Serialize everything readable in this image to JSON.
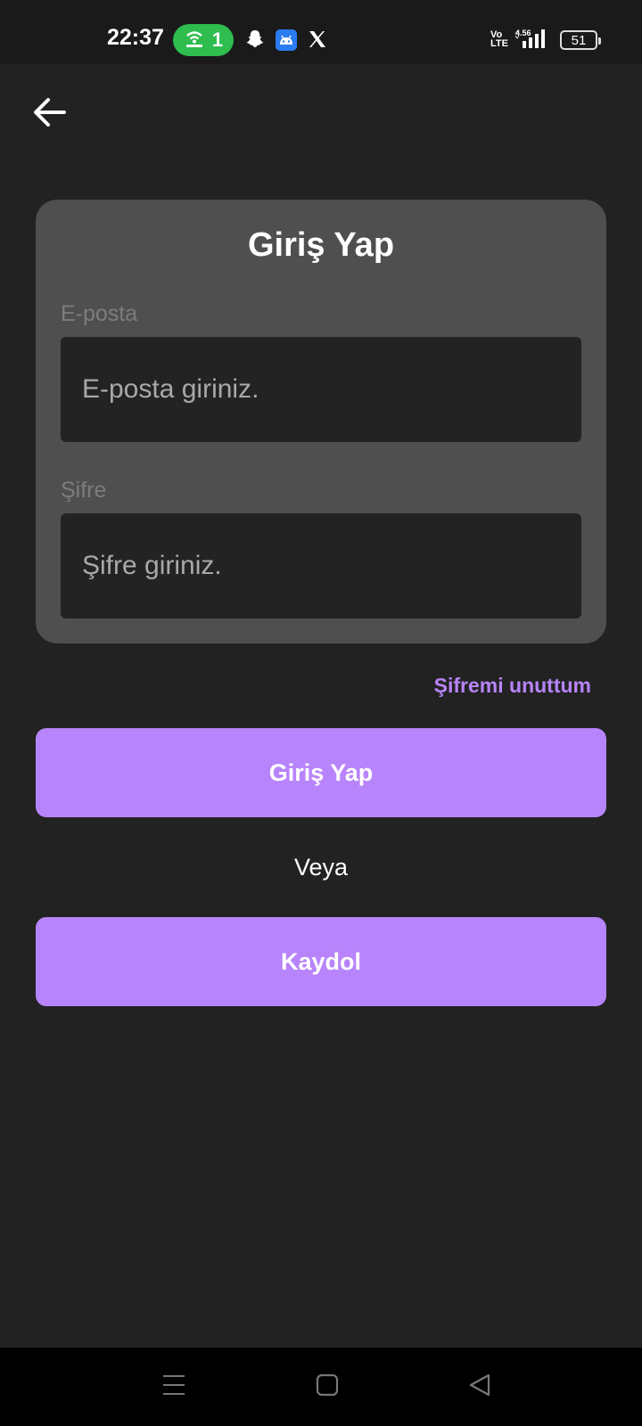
{
  "status_bar": {
    "time": "22:37",
    "hotspot_count": "1",
    "volte_label": "Vo\nLTE",
    "net_speed": "4.56",
    "battery_level": "51",
    "icons": [
      "hotspot-icon",
      "snapchat-icon",
      "android-icon",
      "x-icon",
      "signal-icon",
      "battery-icon"
    ]
  },
  "header": {
    "back_icon": "arrow-left-icon"
  },
  "login_card": {
    "title": "Giriş Yap",
    "email": {
      "label": "E-posta",
      "placeholder": "E-posta giriniz.",
      "value": ""
    },
    "password": {
      "label": "Şifre",
      "placeholder": "Şifre giriniz.",
      "value": ""
    }
  },
  "forgot_password_label": "Şifremi unuttum",
  "login_button_label": "Giriş Yap",
  "or_label": "Veya",
  "signup_button_label": "Kaydol",
  "nav_bar": {
    "icons": [
      "recents-icon",
      "home-icon",
      "back-icon"
    ]
  },
  "colors": {
    "background": "#222222",
    "card": "#4f4f4f",
    "input": "#232323",
    "accent": "#b884fb",
    "link": "#b784f7",
    "hotspot": "#2ebd4e"
  }
}
